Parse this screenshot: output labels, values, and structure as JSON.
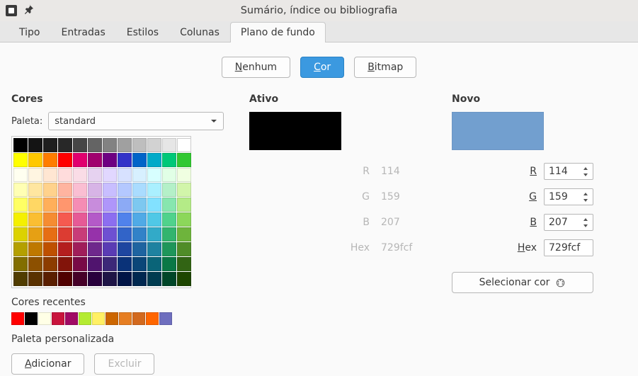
{
  "window": {
    "title": "Sumário, índice ou bibliografia"
  },
  "tabs": [
    {
      "label": "Tipo"
    },
    {
      "label": "Entradas"
    },
    {
      "label": "Estilos"
    },
    {
      "label": "Colunas"
    },
    {
      "label": "Plano de fundo"
    }
  ],
  "mode": {
    "none": {
      "label": "Nenhum",
      "ul": "N"
    },
    "color": {
      "label": "Cor",
      "ul": "C"
    },
    "bitmap": {
      "label": "Bitmap",
      "ul": "B"
    }
  },
  "cores": {
    "heading": "Cores",
    "palette_label": "Paleta:",
    "palette_value": "standard",
    "grid": [
      [
        "#000000",
        "#141414",
        "#1e1e1e",
        "#282828",
        "#464646",
        "#646464",
        "#828282",
        "#a0a0a0",
        "#bebebe",
        "#d2d2d2",
        "#e6e6e6",
        "#ffffff"
      ],
      [
        "#ffff00",
        "#ffc800",
        "#ff7d00",
        "#ff0000",
        "#e1006e",
        "#a0006e",
        "#6e0082",
        "#3232c8",
        "#0064c8",
        "#00aac8",
        "#00c878",
        "#32c832"
      ],
      [
        "#fffff0",
        "#fff5e1",
        "#ffe6d2",
        "#ffdcdc",
        "#fadce6",
        "#e6d2f0",
        "#e1d7ff",
        "#d7e1ff",
        "#d7f0ff",
        "#d7ffff",
        "#e1ffe6",
        "#f0ffe1"
      ],
      [
        "#ffffb4",
        "#ffe6a0",
        "#ffd28c",
        "#ffb4a0",
        "#fabed2",
        "#d7b4e6",
        "#c8beff",
        "#b4c8ff",
        "#aadcff",
        "#aaf0ff",
        "#b4f0c8",
        "#d2f5aa"
      ],
      [
        "#ffff64",
        "#ffd764",
        "#ffaf5a",
        "#ff966e",
        "#f58cb4",
        "#c88cdc",
        "#af96fa",
        "#8caaf5",
        "#7dc8f0",
        "#82e1ff",
        "#87e6af",
        "#b4eb87"
      ],
      [
        "#f5f000",
        "#fabe32",
        "#f58c32",
        "#f55a50",
        "#e65a96",
        "#b45ac8",
        "#8c6ef0",
        "#5082eb",
        "#50aae6",
        "#50c8e6",
        "#50d28c",
        "#8cd75a"
      ],
      [
        "#dcd200",
        "#e6a014",
        "#e66e14",
        "#dc3c32",
        "#c83c78",
        "#9632aa",
        "#6e50d2",
        "#3264c8",
        "#3282c8",
        "#32aac8",
        "#32b46e",
        "#6eb43c"
      ],
      [
        "#b4a000",
        "#be7800",
        "#be5000",
        "#b41e1e",
        "#a01e5a",
        "#6e288c",
        "#5a3cb4",
        "#1e46a0",
        "#1e64a0",
        "#1e82a0",
        "#1e965a",
        "#508c28"
      ],
      [
        "#826e00",
        "#8c5000",
        "#8c3c00",
        "#82140a",
        "#780a46",
        "#50146e",
        "#3c2878",
        "#0a3278",
        "#0a4678",
        "#0a6478",
        "#0a7846",
        "#326414"
      ],
      [
        "#503c00",
        "#5a3200",
        "#5a1e00",
        "#500000",
        "#460028",
        "#28003c",
        "#1e1446",
        "#001446",
        "#002850",
        "#003c50",
        "#004628",
        "#1e4600"
      ]
    ],
    "recent_label": "Cores recentes",
    "recent": [
      "#ff0000",
      "#000000",
      "#ffffe6",
      "#c8143c",
      "#a00a64",
      "#b4eb32",
      "#fff064",
      "#cc6600",
      "#e67e22",
      "#d2691e",
      "#ff6600",
      "#6e6ebe"
    ],
    "custom_label": "Paleta personalizada",
    "add_label": "Adicionar",
    "delete_label": "Excluir"
  },
  "ativo": {
    "heading": "Ativo",
    "preview_color": "#000000",
    "r_label": "R",
    "r": "114",
    "g_label": "G",
    "g": "159",
    "b_label": "B",
    "b": "207",
    "hex_label": "Hex",
    "hex": "729fcf"
  },
  "novo": {
    "heading": "Novo",
    "preview_color": "#729fcf",
    "r_label": "R",
    "r": "114",
    "g_label": "G",
    "g": "159",
    "b_label": "B",
    "b": "207",
    "hex_label": "Hex",
    "hex": "729fcf",
    "picker_label": "Selecionar cor"
  }
}
